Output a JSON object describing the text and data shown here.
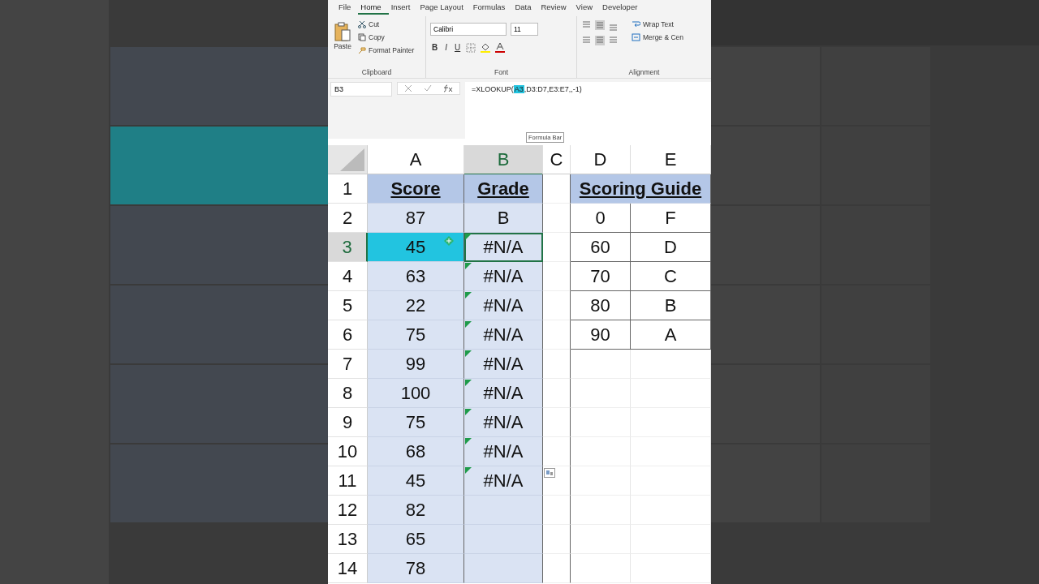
{
  "menu_tabs": [
    {
      "label": "File",
      "selected": false
    },
    {
      "label": "Home",
      "selected": true
    },
    {
      "label": "Insert",
      "selected": false
    },
    {
      "label": "Page Layout",
      "selected": false
    },
    {
      "label": "Formulas",
      "selected": false
    },
    {
      "label": "Data",
      "selected": false
    },
    {
      "label": "Review",
      "selected": false
    },
    {
      "label": "View",
      "selected": false
    },
    {
      "label": "Developer",
      "selected": false
    }
  ],
  "clipboard": {
    "paste": "Paste",
    "cut": "Cut",
    "copy": "Copy",
    "format_painter": "Format Painter",
    "group": "Clipboard"
  },
  "font": {
    "name": "Calibri",
    "size": "11",
    "bold": "B",
    "italic": "I",
    "underline": "U",
    "group": "Font"
  },
  "alignment": {
    "wrap_text": "Wrap Text",
    "merge": "Merge & Cen",
    "group": "Alignment"
  },
  "name_box": "B3",
  "formula": {
    "before": "=XLOOKUP(",
    "reference": "A3",
    "after": ",D3:D7,E3:E7,,-1)"
  },
  "tooltip": "Formula Bar",
  "columns": [
    {
      "label": "A",
      "selected": false
    },
    {
      "label": "B",
      "selected": true
    },
    {
      "label": "C",
      "selected": false
    },
    {
      "label": "D",
      "selected": false
    },
    {
      "label": "E",
      "selected": false
    }
  ],
  "rows": [
    {
      "header": "1",
      "selected": false,
      "a": "Score",
      "b": "Grade",
      "d": "Scoring Guide",
      "error": false,
      "referenced": false
    },
    {
      "header": "2",
      "selected": false,
      "a": "87",
      "b": "B",
      "d": "0",
      "e": "F",
      "error": false,
      "referenced": false
    },
    {
      "header": "3",
      "selected": true,
      "a": "45",
      "b": "#N/A",
      "d": "60",
      "e": "D",
      "error": true,
      "referenced": true
    },
    {
      "header": "4",
      "selected": false,
      "a": "63",
      "b": "#N/A",
      "d": "70",
      "e": "C",
      "error": true,
      "referenced": false
    },
    {
      "header": "5",
      "selected": false,
      "a": "22",
      "b": "#N/A",
      "d": "80",
      "e": "B",
      "error": true,
      "referenced": false
    },
    {
      "header": "6",
      "selected": false,
      "a": "75",
      "b": "#N/A",
      "d": "90",
      "e": "A",
      "error": true,
      "referenced": false
    },
    {
      "header": "7",
      "selected": false,
      "a": "99",
      "b": "#N/A",
      "error": true,
      "referenced": false
    },
    {
      "header": "8",
      "selected": false,
      "a": "100",
      "b": "#N/A",
      "error": true,
      "referenced": false
    },
    {
      "header": "9",
      "selected": false,
      "a": "75",
      "b": "#N/A",
      "error": true,
      "referenced": false
    },
    {
      "header": "10",
      "selected": false,
      "a": "68",
      "b": "#N/A",
      "error": true,
      "referenced": false
    },
    {
      "header": "11",
      "selected": false,
      "a": "45",
      "b": "#N/A",
      "error": true,
      "referenced": false
    },
    {
      "header": "12",
      "selected": false,
      "a": "82",
      "error": false,
      "referenced": false
    },
    {
      "header": "13",
      "selected": false,
      "a": "65",
      "error": false,
      "referenced": false
    },
    {
      "header": "14",
      "selected": false,
      "a": "78",
      "error": false,
      "referenced": false
    }
  ]
}
